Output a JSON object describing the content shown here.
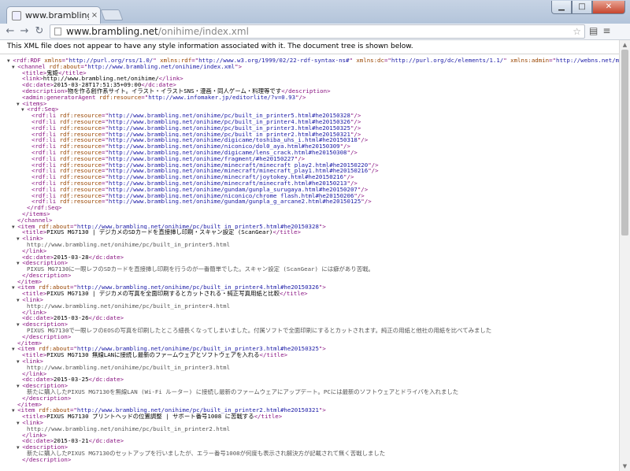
{
  "browser": {
    "tab_title": "www.brambling.net/on",
    "tab_close": "×",
    "url_host": "www.brambling.net",
    "url_path": "/onihime/index.xml",
    "icons": [
      "back-icon",
      "forward-icon",
      "reload-icon",
      "star-icon",
      "page-icon",
      "menu-icon"
    ]
  },
  "notice": "This XML file does not appear to have any style information associated with it. The document tree is shown below.",
  "lines": [
    {
      "i": 0,
      "t": "▼",
      "p": [
        [
          "tag",
          "<rdf:RDF "
        ],
        [
          "an",
          "xmlns"
        ],
        [
          "tag",
          "=\""
        ],
        [
          "av",
          "http://purl.org/rss/1.0/"
        ],
        [
          "tag",
          "\" "
        ],
        [
          "an",
          "xmlns:rdf"
        ],
        [
          "tag",
          "=\""
        ],
        [
          "av",
          "http://www.w3.org/1999/02/22-rdf-syntax-ns#"
        ],
        [
          "tag",
          "\" "
        ],
        [
          "an",
          "xmlns:dc"
        ],
        [
          "tag",
          "=\""
        ],
        [
          "av",
          "http://purl.org/dc/elements/1.1/"
        ],
        [
          "tag",
          "\" "
        ],
        [
          "an",
          "xmlns:admin"
        ],
        [
          "tag",
          "=\""
        ],
        [
          "av",
          "http://webns.net/mvcb/"
        ],
        [
          "tag",
          "\" "
        ],
        [
          "an",
          "xml:lang"
        ],
        [
          "tag",
          "=\""
        ],
        [
          "av",
          "ja"
        ],
        [
          "tag",
          "\">"
        ]
      ]
    },
    {
      "i": 1,
      "t": "▼",
      "p": [
        [
          "tag",
          "<channel "
        ],
        [
          "an",
          "rdf:about"
        ],
        [
          "tag",
          "=\""
        ],
        [
          "av",
          "http://www.brambling.net/onihime/index.xml"
        ],
        [
          "tag",
          "\">"
        ]
      ]
    },
    {
      "i": 2,
      "p": [
        [
          "tag",
          "<title>"
        ],
        [
          "",
          "鬼姫"
        ],
        [
          "tag",
          "</title>"
        ]
      ]
    },
    {
      "i": 2,
      "p": [
        [
          "tag",
          "<link>"
        ],
        [
          "",
          "http://www.brambling.net/onihime/"
        ],
        [
          "tag",
          "</link>"
        ]
      ]
    },
    {
      "i": 2,
      "p": [
        [
          "tag",
          "<dc:date>"
        ],
        [
          "",
          "2015-03-28T17:51:35+09:00"
        ],
        [
          "tag",
          "</dc:date>"
        ]
      ]
    },
    {
      "i": 2,
      "p": [
        [
          "tag",
          "<description>"
        ],
        [
          "",
          "物を作る創作系サイト。イラスト・イラストSNS・漫画・同人ゲーム・料理等です"
        ],
        [
          "tag",
          "</description>"
        ]
      ]
    },
    {
      "i": 2,
      "p": [
        [
          "tag",
          "<admin:generatorAgent "
        ],
        [
          "an",
          "rdf:resource"
        ],
        [
          "tag",
          "=\""
        ],
        [
          "av",
          "http://www.infomaker.jp/editorlite/?v=0.93"
        ],
        [
          "tag",
          "\"/>"
        ]
      ]
    },
    {
      "i": 2,
      "t": "▼",
      "p": [
        [
          "tag",
          "<items>"
        ]
      ]
    },
    {
      "i": 3,
      "t": "▼",
      "p": [
        [
          "tag",
          "<rdf:Seq>"
        ]
      ]
    },
    {
      "i": 4,
      "p": [
        [
          "tag",
          "<rdf:li "
        ],
        [
          "an",
          "rdf:resource"
        ],
        [
          "tag",
          "=\""
        ],
        [
          "av",
          "http://www.brambling.net/onihime/pc/built_in_printer5.html#he20150328"
        ],
        [
          "tag",
          "\"/>"
        ]
      ]
    },
    {
      "i": 4,
      "p": [
        [
          "tag",
          "<rdf:li "
        ],
        [
          "an",
          "rdf:resource"
        ],
        [
          "tag",
          "=\""
        ],
        [
          "av",
          "http://www.brambling.net/onihime/pc/built_in_printer4.html#he20150326"
        ],
        [
          "tag",
          "\"/>"
        ]
      ]
    },
    {
      "i": 4,
      "p": [
        [
          "tag",
          "<rdf:li "
        ],
        [
          "an",
          "rdf:resource"
        ],
        [
          "tag",
          "=\""
        ],
        [
          "av",
          "http://www.brambling.net/onihime/pc/built_in_printer3.html#he20150325"
        ],
        [
          "tag",
          "\"/>"
        ]
      ]
    },
    {
      "i": 4,
      "p": [
        [
          "tag",
          "<rdf:li "
        ],
        [
          "an",
          "rdf:resource"
        ],
        [
          "tag",
          "=\""
        ],
        [
          "av",
          "http://www.brambling.net/onihime/pc/built_in_printer2.html#he20150321"
        ],
        [
          "tag",
          "\"/>"
        ]
      ]
    },
    {
      "i": 4,
      "p": [
        [
          "tag",
          "<rdf:li "
        ],
        [
          "an",
          "rdf:resource"
        ],
        [
          "tag",
          "=\""
        ],
        [
          "av",
          "http://www.brambling.net/onihime/digicame/toshiba_uhs_i.html#he20150318"
        ],
        [
          "tag",
          "\"/>"
        ]
      ]
    },
    {
      "i": 4,
      "p": [
        [
          "tag",
          "<rdf:li "
        ],
        [
          "an",
          "rdf:resource"
        ],
        [
          "tag",
          "=\""
        ],
        [
          "av",
          "http://www.brambling.net/onihime/niconico/dol0_aya.html#he20150309"
        ],
        [
          "tag",
          "\"/>"
        ]
      ]
    },
    {
      "i": 4,
      "p": [
        [
          "tag",
          "<rdf:li "
        ],
        [
          "an",
          "rdf:resource"
        ],
        [
          "tag",
          "=\""
        ],
        [
          "av",
          "http://www.brambling.net/onihime/digicame/lens_crack.html#he20150308"
        ],
        [
          "tag",
          "\"/>"
        ]
      ]
    },
    {
      "i": 4,
      "p": [
        [
          "tag",
          "<rdf:li "
        ],
        [
          "an",
          "rdf:resource"
        ],
        [
          "tag",
          "=\""
        ],
        [
          "av",
          "http://www.brambling.net/onihime/fragment/#he20150227"
        ],
        [
          "tag",
          "\"/>"
        ]
      ]
    },
    {
      "i": 4,
      "p": [
        [
          "tag",
          "<rdf:li "
        ],
        [
          "an",
          "rdf:resource"
        ],
        [
          "tag",
          "=\""
        ],
        [
          "av",
          "http://www.brambling.net/onihime/minecraft/minecraft_play2.html#he20150220"
        ],
        [
          "tag",
          "\"/>"
        ]
      ]
    },
    {
      "i": 4,
      "p": [
        [
          "tag",
          "<rdf:li "
        ],
        [
          "an",
          "rdf:resource"
        ],
        [
          "tag",
          "=\""
        ],
        [
          "av",
          "http://www.brambling.net/onihime/minecraft/minecraft_play1.html#he20150216"
        ],
        [
          "tag",
          "\"/>"
        ]
      ]
    },
    {
      "i": 4,
      "p": [
        [
          "tag",
          "<rdf:li "
        ],
        [
          "an",
          "rdf:resource"
        ],
        [
          "tag",
          "=\""
        ],
        [
          "av",
          "http://www.brambling.net/onihime/minecraft/joytokey.html#he20150216"
        ],
        [
          "tag",
          "\"/>"
        ]
      ]
    },
    {
      "i": 4,
      "p": [
        [
          "tag",
          "<rdf:li "
        ],
        [
          "an",
          "rdf:resource"
        ],
        [
          "tag",
          "=\""
        ],
        [
          "av",
          "http://www.brambling.net/onihime/minecraft/minecraft.html#he20150213"
        ],
        [
          "tag",
          "\"/>"
        ]
      ]
    },
    {
      "i": 4,
      "p": [
        [
          "tag",
          "<rdf:li "
        ],
        [
          "an",
          "rdf:resource"
        ],
        [
          "tag",
          "=\""
        ],
        [
          "av",
          "http://www.brambling.net/onihime/gundam/gunpla_surugaya.html#he20150207"
        ],
        [
          "tag",
          "\"/>"
        ]
      ]
    },
    {
      "i": 4,
      "p": [
        [
          "tag",
          "<rdf:li "
        ],
        [
          "an",
          "rdf:resource"
        ],
        [
          "tag",
          "=\""
        ],
        [
          "av",
          "http://www.brambling.net/onihime/niconico/chrome_flash.html#he20150206"
        ],
        [
          "tag",
          "\"/>"
        ]
      ]
    },
    {
      "i": 4,
      "p": [
        [
          "tag",
          "<rdf:li "
        ],
        [
          "an",
          "rdf:resource"
        ],
        [
          "tag",
          "=\""
        ],
        [
          "av",
          "http://www.brambling.net/onihime/gundam/gunpla_g_arcane2.html#he20150125"
        ],
        [
          "tag",
          "\"/>"
        ]
      ]
    },
    {
      "i": 3,
      "p": [
        [
          "tag",
          "</rdf:Seq>"
        ]
      ]
    },
    {
      "i": 2,
      "p": [
        [
          "tag",
          "</items>"
        ]
      ]
    },
    {
      "i": 1,
      "p": [
        [
          "tag",
          "</channel>"
        ]
      ]
    },
    {
      "i": 1,
      "t": "▼",
      "p": [
        [
          "tag",
          "<item "
        ],
        [
          "an",
          "rdf:about"
        ],
        [
          "tag",
          "=\""
        ],
        [
          "av",
          "http://www.brambling.net/onihime/pc/built_in_printer5.html#he20150328"
        ],
        [
          "tag",
          "\">"
        ]
      ]
    },
    {
      "i": 2,
      "p": [
        [
          "tag",
          "<title>"
        ],
        [
          "",
          "PIXUS MG7130 | デジカメのSDカードを直接挿し印刷・スキャン設定 (ScanGear)"
        ],
        [
          "tag",
          "</title>"
        ]
      ]
    },
    {
      "i": 2,
      "t": "▼",
      "p": [
        [
          "tag",
          "<link>"
        ]
      ]
    },
    {
      "i": 3,
      "p": [
        [
          "tw",
          "http://www.brambling.net/onihime/pc/built_in_printer5.html"
        ]
      ]
    },
    {
      "i": 2,
      "p": [
        [
          "tag",
          "</link>"
        ]
      ]
    },
    {
      "i": 2,
      "p": [
        [
          "tag",
          "<dc:date>"
        ],
        [
          "",
          "2015-03-28"
        ],
        [
          "tag",
          "</dc:date>"
        ]
      ]
    },
    {
      "i": 2,
      "t": "▼",
      "p": [
        [
          "tag",
          "<description>"
        ]
      ]
    },
    {
      "i": 3,
      "p": [
        [
          "tw",
          "PIXUS MG7130に一眼レフのSDカードを直接挿し印刷を行うのが一番簡単でした。スキャン設定 (ScanGear) には癖があり苦戦。"
        ]
      ]
    },
    {
      "i": 2,
      "p": [
        [
          "tag",
          "</description>"
        ]
      ]
    },
    {
      "i": 1,
      "p": [
        [
          "tag",
          "</item>"
        ]
      ]
    },
    {
      "i": 1,
      "t": "▼",
      "p": [
        [
          "tag",
          "<item "
        ],
        [
          "an",
          "rdf:about"
        ],
        [
          "tag",
          "=\""
        ],
        [
          "av",
          "http://www.brambling.net/onihime/pc/built_in_printer4.html#he20150326"
        ],
        [
          "tag",
          "\">"
        ]
      ]
    },
    {
      "i": 2,
      "p": [
        [
          "tag",
          "<title>"
        ],
        [
          "",
          "PIXUS MG7130 | デジカメの写真を全面印刷するとカットされる・純正写真用紙と比較"
        ],
        [
          "tag",
          "</title>"
        ]
      ]
    },
    {
      "i": 2,
      "t": "▼",
      "p": [
        [
          "tag",
          "<link>"
        ]
      ]
    },
    {
      "i": 3,
      "p": [
        [
          "tw",
          "http://www.brambling.net/onihime/pc/built_in_printer4.html"
        ]
      ]
    },
    {
      "i": 2,
      "p": [
        [
          "tag",
          "</link>"
        ]
      ]
    },
    {
      "i": 2,
      "p": [
        [
          "tag",
          "<dc:date>"
        ],
        [
          "",
          "2015-03-26"
        ],
        [
          "tag",
          "</dc:date>"
        ]
      ]
    },
    {
      "i": 2,
      "t": "▼",
      "p": [
        [
          "tag",
          "<description>"
        ]
      ]
    },
    {
      "i": 3,
      "p": [
        [
          "tw",
          "PIXUS MG7130で一眼レフのEOSの写真を印刷したところ細長くなってしまいました。付属ソフトで全面印刷にするとカットされます。純正の用紙と他社の用紙を比べてみました"
        ]
      ]
    },
    {
      "i": 2,
      "p": [
        [
          "tag",
          "</description>"
        ]
      ]
    },
    {
      "i": 1,
      "p": [
        [
          "tag",
          "</item>"
        ]
      ]
    },
    {
      "i": 1,
      "t": "▼",
      "p": [
        [
          "tag",
          "<item "
        ],
        [
          "an",
          "rdf:about"
        ],
        [
          "tag",
          "=\""
        ],
        [
          "av",
          "http://www.brambling.net/onihime/pc/built_in_printer3.html#he20150325"
        ],
        [
          "tag",
          "\">"
        ]
      ]
    },
    {
      "i": 2,
      "p": [
        [
          "tag",
          "<title>"
        ],
        [
          "",
          "PIXUS MG7130 無線LANに接続し最新のファームウェアとソフトウェアを入れる"
        ],
        [
          "tag",
          "</title>"
        ]
      ]
    },
    {
      "i": 2,
      "t": "▼",
      "p": [
        [
          "tag",
          "<link>"
        ]
      ]
    },
    {
      "i": 3,
      "p": [
        [
          "tw",
          "http://www.brambling.net/onihime/pc/built_in_printer3.html"
        ]
      ]
    },
    {
      "i": 2,
      "p": [
        [
          "tag",
          "</link>"
        ]
      ]
    },
    {
      "i": 2,
      "p": [
        [
          "tag",
          "<dc:date>"
        ],
        [
          "",
          "2015-03-25"
        ],
        [
          "tag",
          "</dc:date>"
        ]
      ]
    },
    {
      "i": 2,
      "t": "▼",
      "p": [
        [
          "tag",
          "<description>"
        ]
      ]
    },
    {
      "i": 3,
      "p": [
        [
          "tw",
          "新たに購入したPIXUS MG7130を無線LAN (Wi-Fi ルーター) に接続し最新のファームウェアにアップデート。PCには最新のソフトウェアとドライバを入れました"
        ]
      ]
    },
    {
      "i": 2,
      "p": [
        [
          "tag",
          "</description>"
        ]
      ]
    },
    {
      "i": 1,
      "p": [
        [
          "tag",
          "</item>"
        ]
      ]
    },
    {
      "i": 1,
      "t": "▼",
      "p": [
        [
          "tag",
          "<item "
        ],
        [
          "an",
          "rdf:about"
        ],
        [
          "tag",
          "=\""
        ],
        [
          "av",
          "http://www.brambling.net/onihime/pc/built_in_printer2.html#he20150321"
        ],
        [
          "tag",
          "\">"
        ]
      ]
    },
    {
      "i": 2,
      "p": [
        [
          "tag",
          "<title>"
        ],
        [
          "",
          "PIXUS MG7130 プリントヘッドの位置調整 | サポート番号1008 に苦戦する"
        ],
        [
          "tag",
          "</title>"
        ]
      ]
    },
    {
      "i": 2,
      "t": "▼",
      "p": [
        [
          "tag",
          "<link>"
        ]
      ]
    },
    {
      "i": 3,
      "p": [
        [
          "tw",
          "http://www.brambling.net/onihime/pc/built_in_printer2.html"
        ]
      ]
    },
    {
      "i": 2,
      "p": [
        [
          "tag",
          "</link>"
        ]
      ]
    },
    {
      "i": 2,
      "p": [
        [
          "tag",
          "<dc:date>"
        ],
        [
          "",
          "2015-03-21"
        ],
        [
          "tag",
          "</dc:date>"
        ]
      ]
    },
    {
      "i": 2,
      "t": "▼",
      "p": [
        [
          "tag",
          "<description>"
        ]
      ]
    },
    {
      "i": 3,
      "p": [
        [
          "tw",
          "新たに購入したPIXUS MG7130のセットアップを行いましたが、エラー番号1008が何度も表示され解決方が記載されて無く苦戦しました"
        ]
      ]
    },
    {
      "i": 2,
      "p": [
        [
          "tag",
          "</description>"
        ]
      ]
    }
  ]
}
